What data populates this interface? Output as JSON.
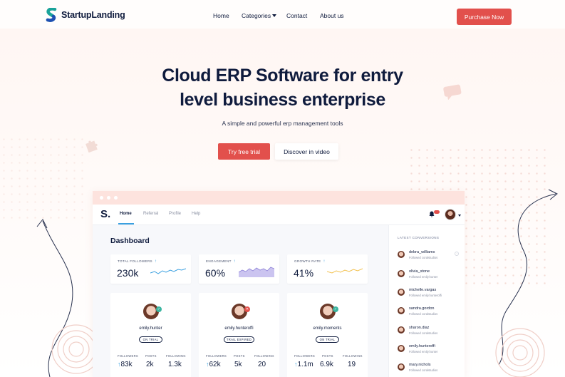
{
  "brand": {
    "name": "StartupLanding",
    "accent": "#e2504c",
    "dark": "#0f1b3d"
  },
  "nav": {
    "links": [
      "Home",
      "Categories",
      "Contact",
      "About us"
    ],
    "purchase_label": "Purchase Now"
  },
  "hero": {
    "title_line1": "Cloud ERP Software for entry",
    "title_line2": "level business enterprise",
    "subtitle": "A simple and powerful erp management tools",
    "primary_cta": "Try free trial",
    "secondary_cta": "Discover in video"
  },
  "app": {
    "logo": "S.",
    "tabs": [
      "Home",
      "Referral",
      "Profile",
      "Help"
    ],
    "active_tab": "Home",
    "notification_badge_icon": "bell-icon",
    "dashboard_title": "Dashboard",
    "stats": [
      {
        "label": "TOTAL FOLLOWERS",
        "value": "230k",
        "color": "#3aa0e0"
      },
      {
        "label": "ENGAGEMENT",
        "value": "60%",
        "color": "#8b7fd6"
      },
      {
        "label": "GROWTH RATE",
        "value": "41%",
        "color": "#f2c14e"
      }
    ],
    "cards": [
      {
        "name": "emily.hunter",
        "status": "ON TRIAL",
        "badge_color": "#3ab5a0",
        "badge_icon": "check-icon",
        "labels": [
          "FOLLOWERS",
          "POSTS",
          "FOLLOWING"
        ],
        "followers": "83k",
        "posts": "2k",
        "following": "1.3k"
      },
      {
        "name": "emily.hunteroffi",
        "status": "TRAIL EXPIRED",
        "badge_color": "#e2504c",
        "badge_icon": "x-icon",
        "labels": [
          "FOLLOWERS",
          "POSTS",
          "FOLLOWING"
        ],
        "followers": "62k",
        "posts": "5k",
        "following": "20"
      },
      {
        "name": "emily.moments",
        "status": "ON TRIAL",
        "badge_color": "#3ab5a0",
        "badge_icon": "check-icon",
        "labels": [
          "FOLLOWERS",
          "POSTS",
          "FOLLOWING"
        ],
        "followers": "1.1m",
        "posts": "6.9k",
        "following": "19"
      }
    ],
    "sidebar": {
      "title": "LATEST CONVERSIONS",
      "items": [
        {
          "name": "debra_williams",
          "sub": "Followed coralstudios"
        },
        {
          "name": "olivia_stone",
          "sub": "Followed emily.hunter"
        },
        {
          "name": "michelle.vargas",
          "sub": "Followed emily.hunteroffi"
        },
        {
          "name": "sandra.gordon",
          "sub": "Followed coralstudios"
        },
        {
          "name": "sharon.diaz",
          "sub": "Followed coralstudios"
        },
        {
          "name": "emily.hunteroffi",
          "sub": "Followed emily.hunter"
        },
        {
          "name": "mary.nichols",
          "sub": "Followed coralstudios"
        }
      ]
    }
  }
}
